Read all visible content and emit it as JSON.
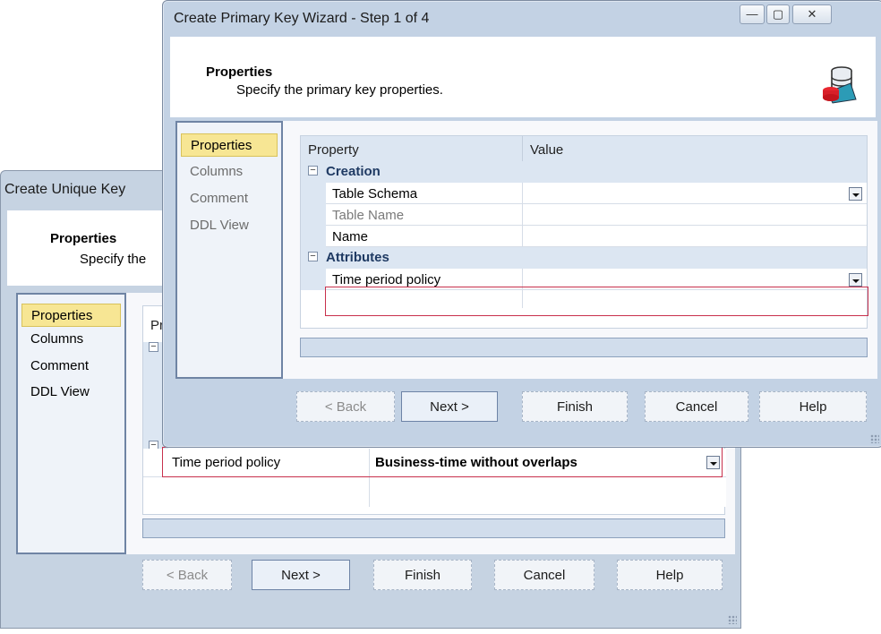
{
  "back_dialog": {
    "title": "Create Unique Key",
    "header": {
      "title": "Properties",
      "subtitle": "Specify the"
    },
    "nav": [
      "Properties",
      "Columns",
      "Comment",
      "DDL View"
    ],
    "grid": {
      "header_partial": "Pr",
      "row": {
        "name": "Time period policy",
        "value": "Business-time without overlaps"
      }
    },
    "buttons": {
      "back": "< Back",
      "next": "Next >",
      "finish": "Finish",
      "cancel": "Cancel",
      "help": "Help"
    }
  },
  "front_dialog": {
    "title": "Create Primary Key Wizard - Step 1 of 4",
    "window_controls": {
      "minimize": "—",
      "maximize": "▢",
      "close": "✕"
    },
    "header": {
      "title": "Properties",
      "subtitle": "Specify the primary key properties.",
      "icon": "database-key-icon"
    },
    "nav": [
      "Properties",
      "Columns",
      "Comment",
      "DDL View"
    ],
    "grid": {
      "columns": [
        "Property",
        "Value"
      ],
      "categories": [
        {
          "name": "Creation",
          "rows": [
            "Table Schema",
            "Table Name",
            "Name"
          ]
        },
        {
          "name": "Attributes",
          "rows": [
            "Time period policy"
          ]
        }
      ]
    },
    "buttons": {
      "back": "< Back",
      "next": "Next >",
      "finish": "Finish",
      "cancel": "Cancel",
      "help": "Help"
    }
  },
  "colors": {
    "highlight": "#c8304c",
    "nav_active": "#f7e694",
    "category_bg": "#dce6f2"
  }
}
